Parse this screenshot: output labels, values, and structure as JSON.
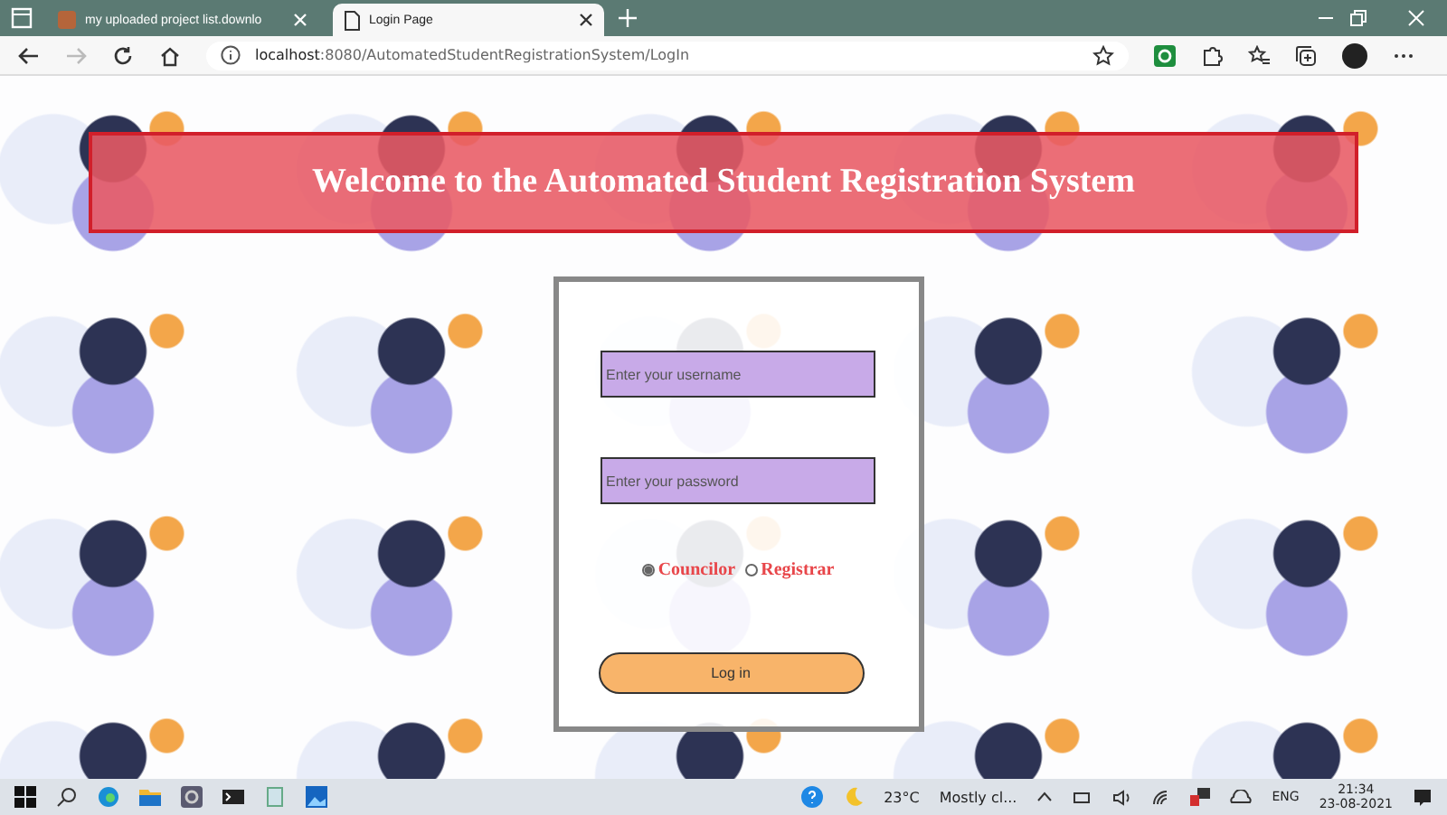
{
  "browser": {
    "tabs": [
      {
        "title": "my uploaded project list.downlo",
        "selected": false
      },
      {
        "title": "Login Page",
        "selected": true
      }
    ],
    "url_host": "localhost",
    "url_rest": ":8080/AutomatedStudentRegistrationSystem/LogIn"
  },
  "banner": {
    "title": "Welcome to the Automated Student Registration System"
  },
  "login": {
    "username": {
      "placeholder": "Enter your username"
    },
    "password": {
      "placeholder": "Enter your password"
    },
    "roles": [
      {
        "label": "Councilor",
        "selected": true
      },
      {
        "label": "Registrar",
        "selected": false
      }
    ],
    "button": "Log in"
  },
  "taskbar": {
    "temperature": "23°C",
    "weather": "Mostly cl...",
    "language": "ENG",
    "time": "21:34",
    "date": "23-08-2021"
  }
}
